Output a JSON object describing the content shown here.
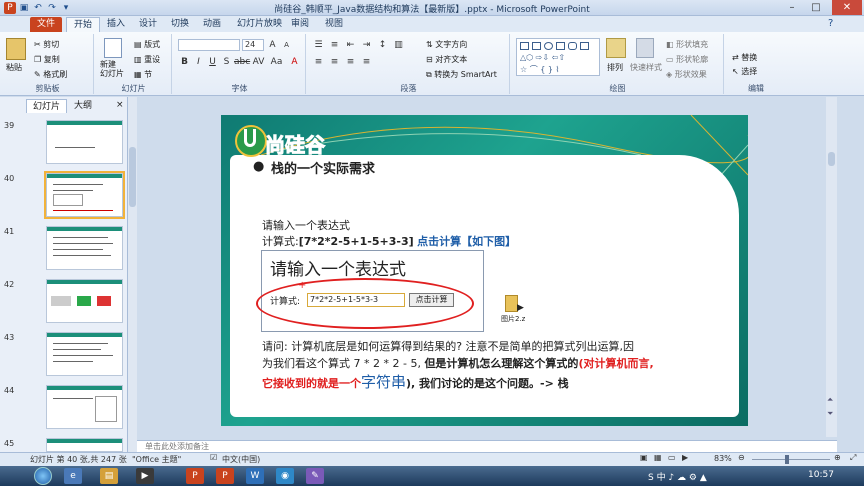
{
  "window": {
    "title": "尚硅谷_韩顺平_Java数据结构和算法【最新版】.pptx - Microsoft PowerPoint",
    "controls": [
      "–",
      "□",
      "✕"
    ]
  },
  "tabs": [
    "文件",
    "开始",
    "插入",
    "设计",
    "切换",
    "动画",
    "幻灯片放映",
    "审阅",
    "视图"
  ],
  "ribbon": {
    "clipboard": {
      "paste": "粘贴",
      "cut": "剪切",
      "copy": "复制",
      "format_painter": "格式刷",
      "label": "剪贴板"
    },
    "slides": {
      "new_slide": "新建\n幻灯片",
      "layout": "版式",
      "reset": "重设",
      "section": "节",
      "label": "幻灯片"
    },
    "font": {
      "font_name": "",
      "font_size": "24",
      "label": "字体"
    },
    "paragraph": {
      "text_direction": "文字方向",
      "align_text": "对齐文本",
      "smartart": "转换为 SmartArt",
      "label": "段落"
    },
    "drawing": {
      "arrange": "排列",
      "quick_styles": "快速样式",
      "fill": "形状填充",
      "outline": "形状轮廓",
      "effects": "形状效果",
      "label": "绘图"
    },
    "editing": {
      "replace": "替换",
      "select": "选择",
      "label": "编辑"
    }
  },
  "left_pane": {
    "tabs": [
      "幻灯片",
      "大纲"
    ],
    "slide_numbers": [
      "39",
      "40",
      "41",
      "42",
      "43",
      "44",
      "45"
    ]
  },
  "slide": {
    "logo_text": "尚硅谷",
    "bullet_title": "栈的一个实际需求",
    "prompt_line": "请输入一个表达式",
    "calc_label": "计算式:",
    "calc_expr": "[7*2*2-5+1-5+3-3]",
    "calc_hint": "点击计算【如下图】",
    "box_title": "请输入一个表达式",
    "box_calc_label": "计算式:",
    "box_input": "7*2*2-5+1-5*3-3",
    "box_button": "点击计算",
    "plus": "+",
    "file_icon_label": "图片2.z",
    "q_line1": "请问: 计算机底层是如何运算得到结果的?  注意不是简单的把算式列出运算,因",
    "q_line2_a": "为我们看这个算式 7 * 2 * 2 - 5, ",
    "q_line2_b": "但是计算机怎么理解这个算式的",
    "q_line2_c": "(对计算机而言,",
    "q_line3_a": "它接收到的就是一个",
    "q_line3_b": "字符串",
    "q_line3_c": "), 我们讨论的是这个问题。-> 栈"
  },
  "notes": {
    "placeholder": "单击此处添加备注"
  },
  "status": {
    "slide_info": "幻灯片 第 40 张,共 247 张",
    "theme": "\"Office 主题\"",
    "language": "中文(中国)",
    "zoom": "83%"
  },
  "taskbar": {
    "time": "10:57"
  }
}
